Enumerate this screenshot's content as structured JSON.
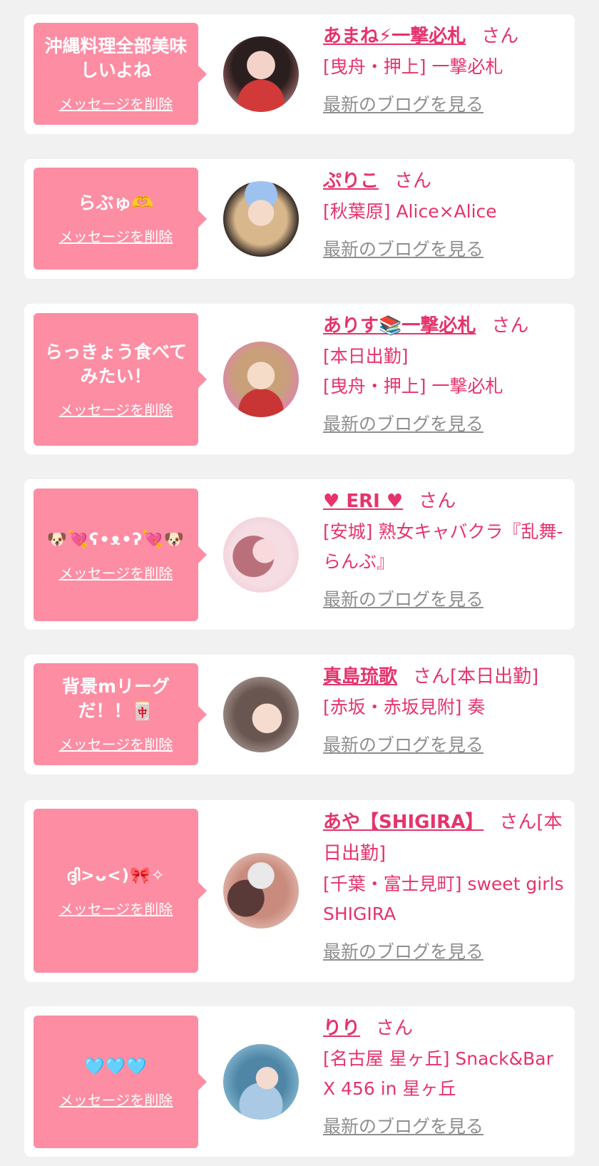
{
  "common": {
    "delete_label": "メッセージを削除",
    "blog_label": "最新のブログを見る",
    "san_label": "さん"
  },
  "cards": [
    {
      "message": "沖縄料理全部美味\nしいよね",
      "name": "あまね⚡一撃必札",
      "after_name": "さん",
      "shops": [
        "[曳舟・押上] 一撃必札"
      ]
    },
    {
      "message": "らぶゅ🫶",
      "name": "ぷりこ",
      "after_name": "さん",
      "shops": [
        "[秋葉原] Alice×Alice"
      ]
    },
    {
      "message": "らっきょう食べて\nみたい！",
      "name": "ありす📚一撃必札",
      "after_name": "さん",
      "shops": [
        "[本日出勤]",
        "[曳舟・押上] 一撃必札"
      ]
    },
    {
      "message": "🐶💘ʕ•ᴥ•ʔ💘🐶",
      "name": "♥ ERI ♥",
      "after_name": "さん",
      "shops": [
        "[安城] 熟女キャバクラ『乱舞-らんぶ』"
      ]
    },
    {
      "message": "背景mリーグ\nだ！！🀄",
      "name": "真島琉歌",
      "after_name": "さん[本日出勤]",
      "shops": [
        "[赤坂・赤坂見附] 奏"
      ]
    },
    {
      "message": "ദ്ദി>ᴗ<)🎀✧",
      "name": "あや【SHIGIRA】",
      "after_name": "さん[本日出勤]",
      "shops": [
        "[千葉・富士見町] sweet girls SHIGIRA"
      ]
    },
    {
      "message": "🩵🩵🩵",
      "name": "りり",
      "after_name": "さん",
      "shops": [
        "[名古屋 星ヶ丘] Snack&Bar X 456 in 星ヶ丘"
      ]
    }
  ]
}
